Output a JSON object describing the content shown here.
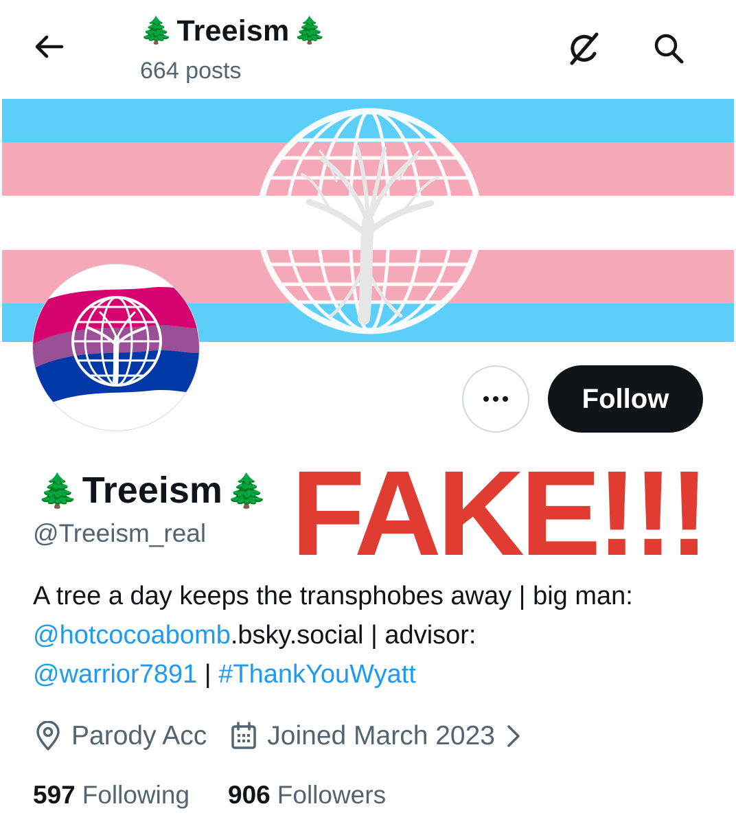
{
  "header": {
    "title": "Treeism",
    "title_emoji_left": "🌲",
    "title_emoji_right": "🌲",
    "posts_count": "664 posts",
    "back_icon": "arrow-left-icon",
    "grok_icon": "grok-icon",
    "search_icon": "search-icon"
  },
  "banner": {
    "stripe_colors": [
      "#5bcefa",
      "#f5a9b8",
      "#ffffff",
      "#f5a9b8",
      "#5bcefa"
    ],
    "emblem": "globe-tree-emblem"
  },
  "avatar": {
    "flag_colors": [
      "#d60270",
      "#9b4f96",
      "#0038a8"
    ],
    "emblem": "globe-tree-emblem"
  },
  "actions": {
    "more_icon": "more-horizontal-icon",
    "follow_label": "Follow"
  },
  "profile": {
    "display_name": "Treeism",
    "name_emoji_left": "🌲",
    "name_emoji_right": "🌲",
    "handle": "@Treeism_real",
    "overlay_text": "FAKE!!!",
    "overlay_color": "#e03c31",
    "bio": {
      "t1": "A tree a day keeps the transphobes away | big man: ",
      "link1": "@hotcocoabomb",
      "t2": ".bsky.social | advisor: ",
      "link2": "@warrior7891",
      "t3": " | ",
      "link3": "#ThankYouWyatt"
    },
    "location": "Parody Acc",
    "location_icon": "location-pin-icon",
    "joined": "Joined March 2023",
    "joined_icon": "calendar-icon",
    "joined_chevron_icon": "chevron-right-icon",
    "following_count": "597",
    "following_label": "Following",
    "followers_count": "906",
    "followers_label": "Followers"
  },
  "colors": {
    "text_primary": "#0f1419",
    "text_secondary": "#536471",
    "link": "#1d9bf0"
  }
}
